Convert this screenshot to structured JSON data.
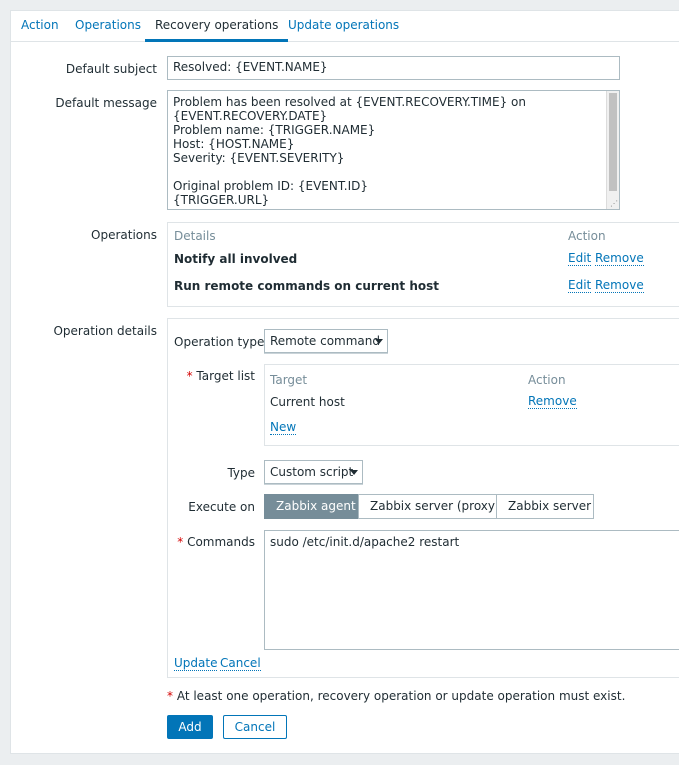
{
  "tabs": [
    {
      "label": "Action",
      "active": false
    },
    {
      "label": "Operations",
      "active": false
    },
    {
      "label": "Recovery operations",
      "active": true
    },
    {
      "label": "Update operations",
      "active": false
    }
  ],
  "form": {
    "default_subject": {
      "label": "Default subject",
      "value": "Resolved: {EVENT.NAME}"
    },
    "default_message": {
      "label": "Default message",
      "lines": [
        "Problem has been resolved at {EVENT.RECOVERY.TIME} on",
        "{EVENT.RECOVERY.DATE}",
        "Problem name: {TRIGGER.NAME}",
        "Host: {HOST.NAME}",
        "Severity: {EVENT.SEVERITY}",
        "",
        "Original problem ID: {EVENT.ID}",
        "{TRIGGER.URL}"
      ]
    },
    "operations": {
      "label": "Operations",
      "header_details": "Details",
      "header_action": "Action",
      "rows": [
        {
          "details": "Notify all involved",
          "edit": "Edit",
          "remove": "Remove"
        },
        {
          "details": "Run remote commands on current host",
          "edit": "Edit",
          "remove": "Remove"
        }
      ]
    },
    "operation_details": {
      "label": "Operation details",
      "operation_type_label": "Operation type",
      "operation_type_value": "Remote command",
      "target_list": {
        "required_mark": "*",
        "label": "Target list",
        "header_target": "Target",
        "header_action": "Action",
        "rows": [
          {
            "target": "Current host",
            "action": "Remove"
          }
        ],
        "new_link": "New"
      },
      "type_label": "Type",
      "type_value": "Custom script",
      "execute_on_label": "Execute on",
      "execute_on_options": [
        "Zabbix agent",
        "Zabbix server (proxy)",
        "Zabbix server"
      ],
      "execute_on_selected": "Zabbix agent",
      "commands_label": "Commands",
      "commands_value": "sudo /etc/init.d/apache2 restart",
      "update_link": "Update",
      "cancel_link": "Cancel"
    },
    "note": "At least one operation, recovery operation or update operation must exist.",
    "note_mark": "*",
    "add_button": "Add",
    "cancel_button": "Cancel"
  },
  "colors": {
    "accent": "#0275b8",
    "required": "#d40000",
    "selected_segment": "#768d99",
    "background": "#ebeef0"
  }
}
